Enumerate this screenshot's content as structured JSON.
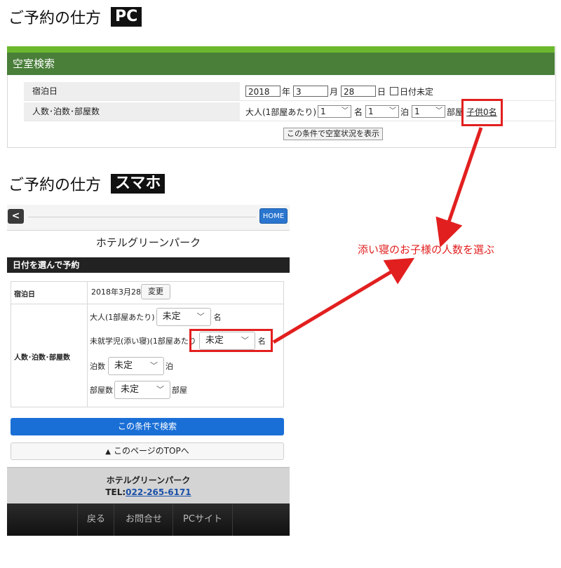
{
  "pc_heading": {
    "title": "ご予約の仕方",
    "badge": "PC"
  },
  "pc_search_panel": {
    "header": "空室検索",
    "row1": {
      "label": "宿泊日",
      "year": "2018",
      "year_unit": "年",
      "month": "3",
      "month_unit": "月",
      "day": "28",
      "day_unit": "日",
      "undecided": "日付未定"
    },
    "row2": {
      "label": "人数･泊数･部屋数",
      "adult_label": "大人(1部屋あたり)",
      "adults": "1",
      "adults_unit": "名",
      "nights": "1",
      "nights_unit": "泊",
      "rooms": "1",
      "rooms_unit": "部屋",
      "children_text": "子供0名"
    },
    "search_button": "この条件で空室状況を表示"
  },
  "sp_heading": {
    "title": "ご予約の仕方",
    "badge": "スマホ"
  },
  "sp": {
    "back": "<",
    "home": "HOME",
    "hotel_name": "ホテルグリーンパーク",
    "section_title": "日付を選んで予約",
    "date_label": "宿泊日",
    "date_value": "2018年3月28日",
    "change_button": "変更",
    "guests_label": "人数･泊数･部屋数",
    "adults_label": "大人(1部屋あたり)",
    "adults_value": "未定",
    "adults_unit": "名",
    "children_label": "未就学児(添い寝)(1部屋あたり",
    "children_value": "未定",
    "children_unit": "名",
    "nights_label": "泊数",
    "nights_value": "未定",
    "nights_unit": "泊",
    "rooms_label": "部屋数",
    "rooms_value": "未定",
    "rooms_unit": "部屋",
    "search_button": "この条件で検索",
    "top_button": "このページのTOPへ",
    "footer_name": "ホテルグリーンパーク",
    "footer_tel_label": "TEL:",
    "footer_tel": "022-265-6171",
    "nav": [
      "戻る",
      "お問合せ",
      "PCサイト"
    ]
  },
  "annotation": {
    "text": "添い寝のお子様の人数を選ぶ",
    "color": "#e21f1f"
  }
}
